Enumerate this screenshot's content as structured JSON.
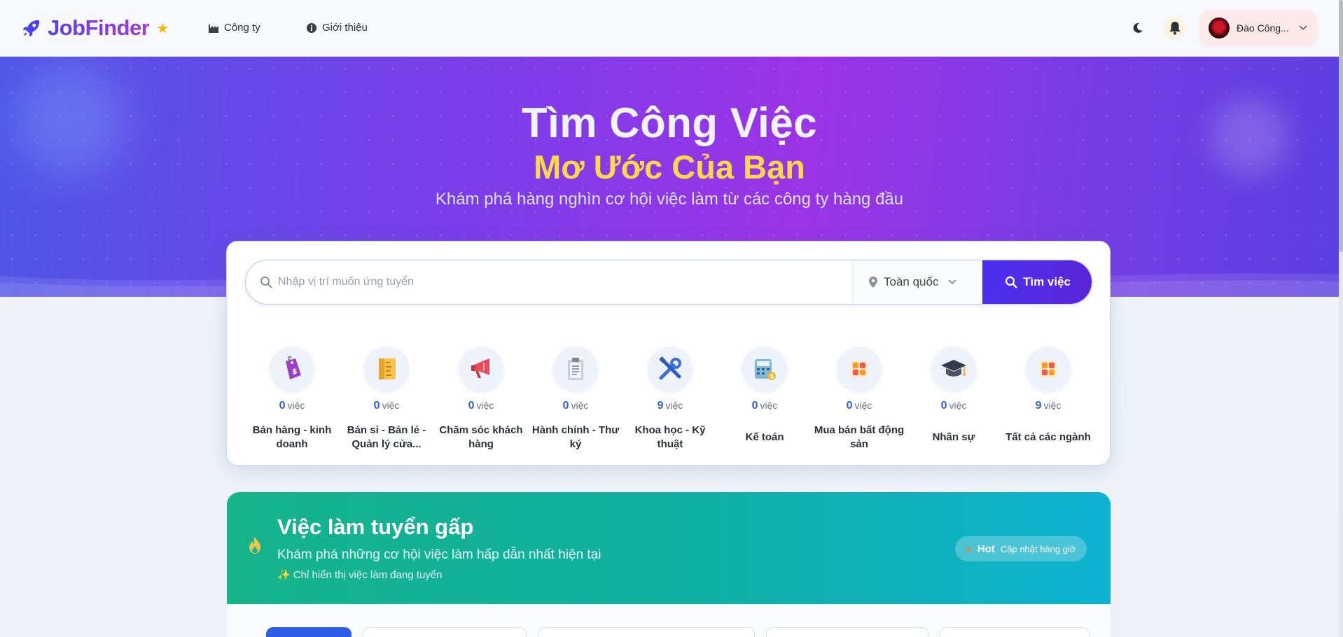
{
  "nav": {
    "brand": "JobFinder",
    "links": [
      {
        "label": "Công ty",
        "icon": "factory-icon"
      },
      {
        "label": "Giới thiệu",
        "icon": "info-icon"
      }
    ],
    "user_name": "Đào Công..."
  },
  "hero": {
    "title": "Tìm Công Việc",
    "subtitle": "Mơ Ước Của Bạn",
    "description": "Khám phá hàng nghìn cơ hội việc làm từ các công ty hàng đầu"
  },
  "search": {
    "placeholder": "Nhập vị trí muốn ứng tuyển",
    "location": "Toàn quốc",
    "button": "Tìm việc"
  },
  "categories": [
    {
      "count": "0",
      "unit": "việc",
      "name": "Bán hàng - kinh doanh",
      "icon": "price-tag-icon"
    },
    {
      "count": "0",
      "unit": "việc",
      "name": "Bán sỉ - Bán lẻ - Quản lý cửa...",
      "icon": "ruler-icon"
    },
    {
      "count": "0",
      "unit": "việc",
      "name": "Chăm sóc khách hàng",
      "icon": "megaphone-icon"
    },
    {
      "count": "0",
      "unit": "việc",
      "name": "Hành chính - Thư ký",
      "icon": "clipboard-icon"
    },
    {
      "count": "9",
      "unit": "việc",
      "name": "Khoa học - Kỹ thuật",
      "icon": "tools-icon"
    },
    {
      "count": "0",
      "unit": "việc",
      "name": "Kế toán",
      "icon": "calculator-icon"
    },
    {
      "count": "0",
      "unit": "việc",
      "name": "Mua bán bất động sản",
      "icon": "grid-icon"
    },
    {
      "count": "0",
      "unit": "việc",
      "name": "Nhân sự",
      "icon": "graduation-cap-icon"
    },
    {
      "count": "9",
      "unit": "việc",
      "name": "Tất cả các ngành",
      "icon": "grid-icon"
    }
  ],
  "urgent": {
    "title": "Việc làm tuyển gấp",
    "subtitle": "Khám phá những cơ hội việc làm hấp dẫn nhất hiện tại",
    "note": "✨ Chỉ hiển thị việc làm đang tuyển",
    "hot_label": "Hot",
    "hot_update": "Cập nhật hàng giờ"
  },
  "colors": {
    "brand": "#5b3df0",
    "accent_yellow": "#fcd94a",
    "search_button": "#4a2ff0",
    "urgent_green": "#15b48a",
    "count_blue": "#2d5fd8"
  }
}
